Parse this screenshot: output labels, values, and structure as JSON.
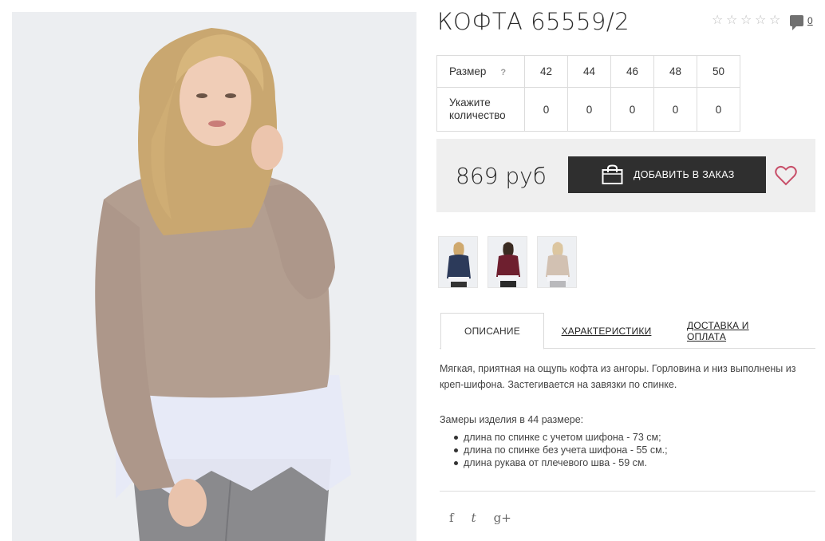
{
  "product": {
    "title": "КОФТА 65559/2",
    "rating_stars": 5,
    "comments_count": "0",
    "main_image_icon": "product-photo"
  },
  "sizes": {
    "size_label": "Размер",
    "help_mark": "?",
    "qty_label": "Укажите количество",
    "columns": [
      "42",
      "44",
      "46",
      "48",
      "50"
    ],
    "quantities": [
      "0",
      "0",
      "0",
      "0",
      "0"
    ]
  },
  "purchase": {
    "price": "869 руб",
    "add_button": "ДОБАВИТЬ В ЗАКАЗ",
    "bag_icon": "shopping-bag-icon",
    "wishlist_icon": "heart-icon"
  },
  "thumbnails": [
    {
      "color": "#2c3a5a",
      "name": "navy"
    },
    {
      "color": "#6e1f2f",
      "name": "burgundy"
    },
    {
      "color": "#c9b7a6",
      "name": "beige"
    }
  ],
  "tabs": {
    "description": "ОПИСАНИЕ",
    "specs": "ХАРАКТЕРИСТИКИ",
    "delivery": "ДОСТАВКА И ОПЛАТА"
  },
  "description": {
    "text": "Мягкая, приятная на ощупь кофта из ангоры. Горловина и низ выполнены из креп-шифона. Застегивается на завязки по спинке.",
    "measurements_title": "Замеры изделия в 44 размере:",
    "measurements": [
      "длина по спинке с учетом шифона - 73 см;",
      "длина по спинке без учета шифона - 55 см.;",
      "длина рукава от плечевого шва - 59 см."
    ]
  },
  "social": {
    "facebook": "f",
    "twitter": "t",
    "googleplus": "g+"
  },
  "colors": {
    "button_bg": "#2f2f2f",
    "price_bg": "#efefef",
    "heart": "#c8506a"
  }
}
